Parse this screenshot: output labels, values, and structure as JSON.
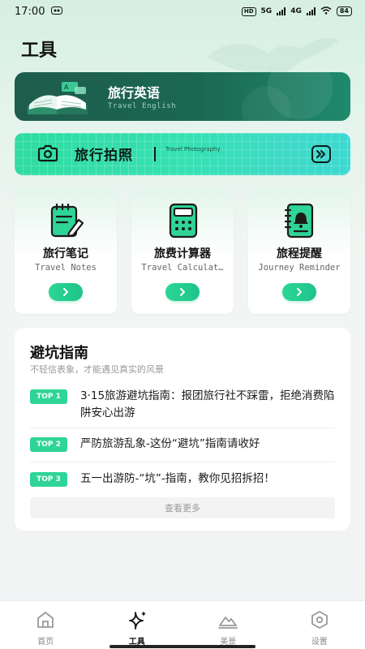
{
  "status_bar": {
    "time": "17:00",
    "network_a": "HD",
    "network_b": "5G",
    "network_c": "4G",
    "battery": "84"
  },
  "page": {
    "title": "工具"
  },
  "english_card": {
    "title": "旅行英语",
    "subtitle": "Travel English"
  },
  "photo_card": {
    "title": "旅行拍照",
    "subtitle": "Travel Photography"
  },
  "tools": [
    {
      "name": "旅行笔记",
      "en": "Travel Notes",
      "icon": "notebook-pen-icon"
    },
    {
      "name": "旅费计算器",
      "en": "Travel Calculat…",
      "icon": "calculator-icon"
    },
    {
      "name": "旅程提醒",
      "en": "Journey Reminder",
      "icon": "bell-notebook-icon"
    }
  ],
  "guide": {
    "title": "避坑指南",
    "subtitle": "不轻信表象，才能遇见真实的风景",
    "items": [
      {
        "tag": "TOP 1",
        "text": "3·15旅游避坑指南：报团旅行社不踩雷，拒绝消费陷阱安心出游"
      },
      {
        "tag": "TOP 2",
        "text": "严防旅游乱象-这份“避坑”指南请收好"
      },
      {
        "tag": "TOP 3",
        "text": "五一出游防-“坑”-指南，教你见招拆招！"
      }
    ],
    "more_label": "查看更多"
  },
  "tabbar": [
    {
      "label": "首页",
      "icon": "home-icon"
    },
    {
      "label": "工具",
      "icon": "sparkle-icon",
      "active": true
    },
    {
      "label": "美景",
      "icon": "mountain-icon"
    },
    {
      "label": "设置",
      "icon": "settings-icon"
    }
  ],
  "colors": {
    "accent": "#2fd497",
    "dark_green": "#1e5c4b",
    "photo_gradient_start": "#2fdca0"
  }
}
